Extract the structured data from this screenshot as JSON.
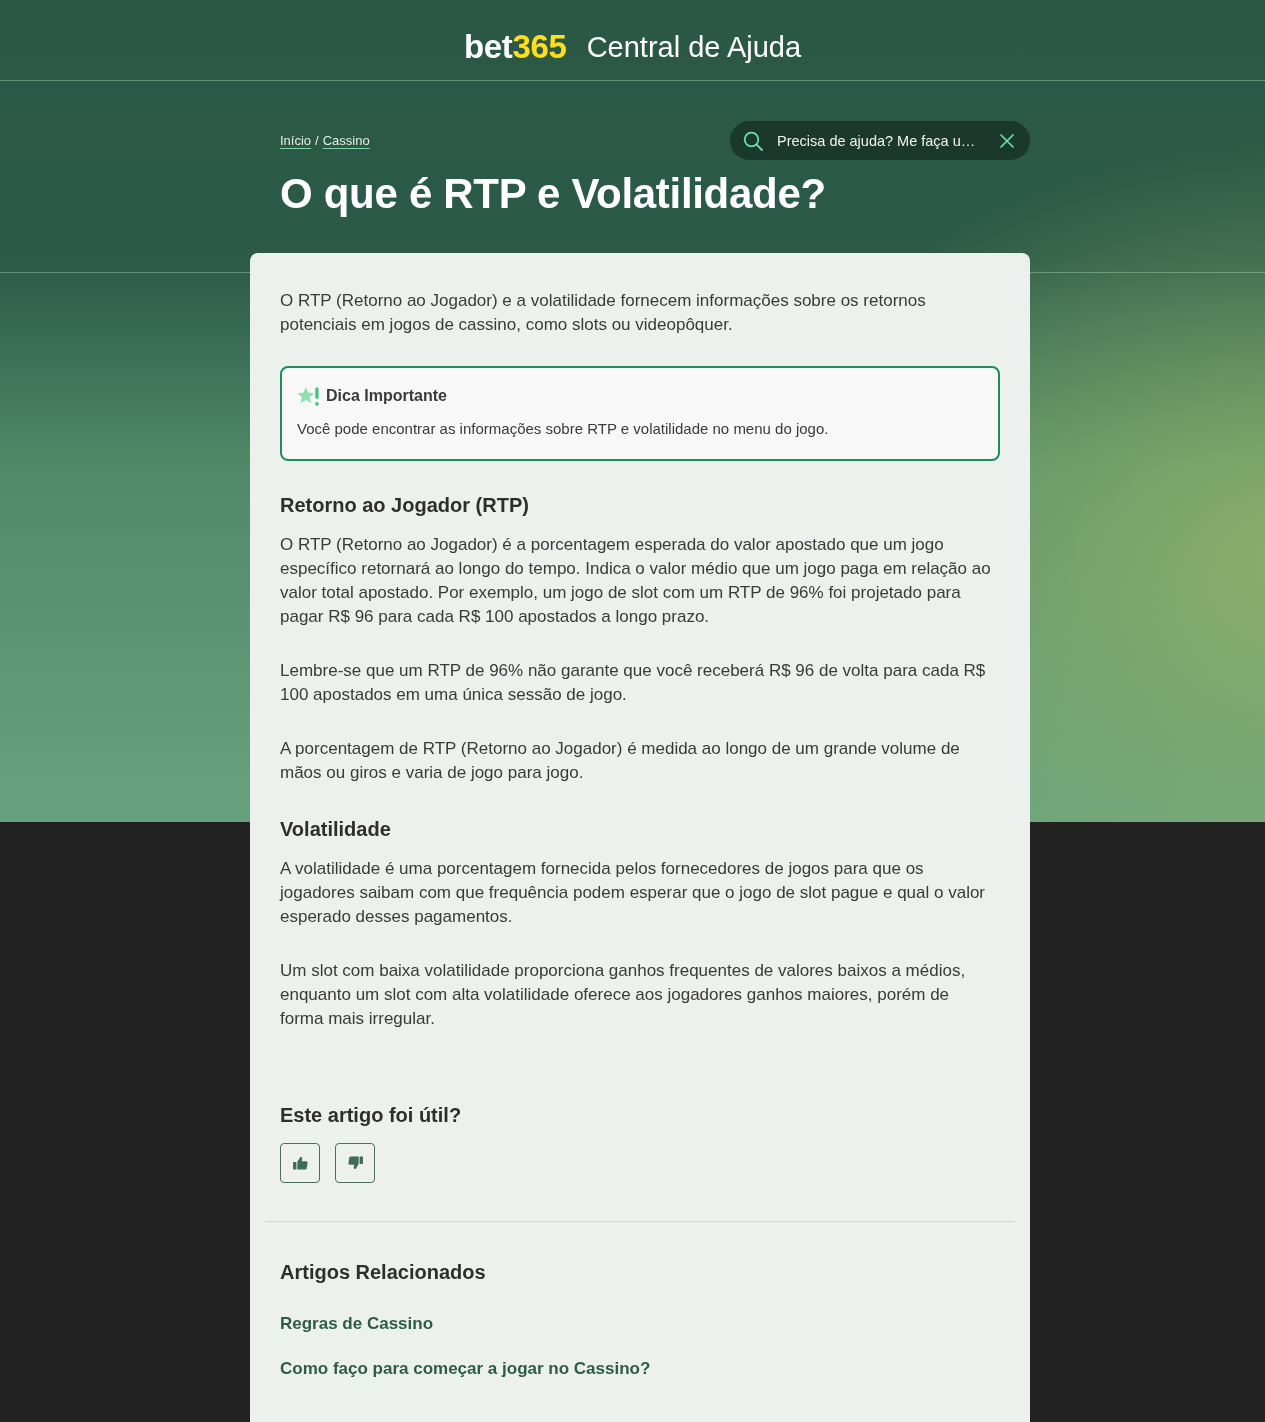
{
  "header": {
    "logo": {
      "text": "bet",
      "accent": "365"
    },
    "title": "Central de Ajuda"
  },
  "breadcrumb": {
    "items": [
      "Início",
      "Cassino"
    ],
    "separator": "/"
  },
  "search": {
    "placeholder": "Precisa de ajuda? Me faça u…"
  },
  "article": {
    "title": "O que é RTP e Volatilidade?",
    "intro": "O RTP (Retorno ao Jogador) e a volatilidade fornecem informações sobre os retornos potenciais em jogos de cassino, como slots ou videopôquer.",
    "tip": {
      "title": "Dica Importante",
      "text": "Você pode encontrar as informações sobre RTP e volatilidade no menu do jogo."
    },
    "sections": [
      {
        "heading": "Retorno ao Jogador (RTP)",
        "paragraphs": [
          "O RTP (Retorno ao Jogador) é a porcentagem esperada do valor apostado que um jogo específico retornará ao longo do tempo. Indica o valor médio que um jogo paga em relação ao valor total apostado. Por exemplo, um jogo de slot com um RTP de 96% foi projetado para pagar R$ 96 para cada R$ 100 apostados a longo prazo.",
          "Lembre-se que um RTP de 96% não garante que você receberá R$ 96 de volta para cada R$ 100 apostados em uma única sessão de jogo.",
          "A porcentagem de RTP (Retorno ao Jogador) é medida ao longo de um grande volume de mãos ou giros e varia de jogo para jogo."
        ]
      },
      {
        "heading": "Volatilidade",
        "paragraphs": [
          "A volatilidade é uma porcentagem fornecida pelos fornecedores de jogos para que os jogadores saibam com que frequência podem esperar que o jogo de slot pague e qual o valor esperado desses pagamentos.",
          "Um slot com baixa volatilidade proporciona ganhos frequentes de valores baixos a médios, enquanto um slot com alta volatilidade oferece aos jogadores ganhos maiores, porém de forma mais irregular."
        ]
      }
    ]
  },
  "feedback": {
    "question": "Este artigo foi útil?",
    "buttons": [
      {
        "kind": "like"
      },
      {
        "kind": "dislike"
      }
    ]
  },
  "related": {
    "heading": "Artigos Relacionados",
    "links": [
      "Regras de Cassino",
      "Como faço para começar a jogar no Cassino?"
    ]
  }
}
